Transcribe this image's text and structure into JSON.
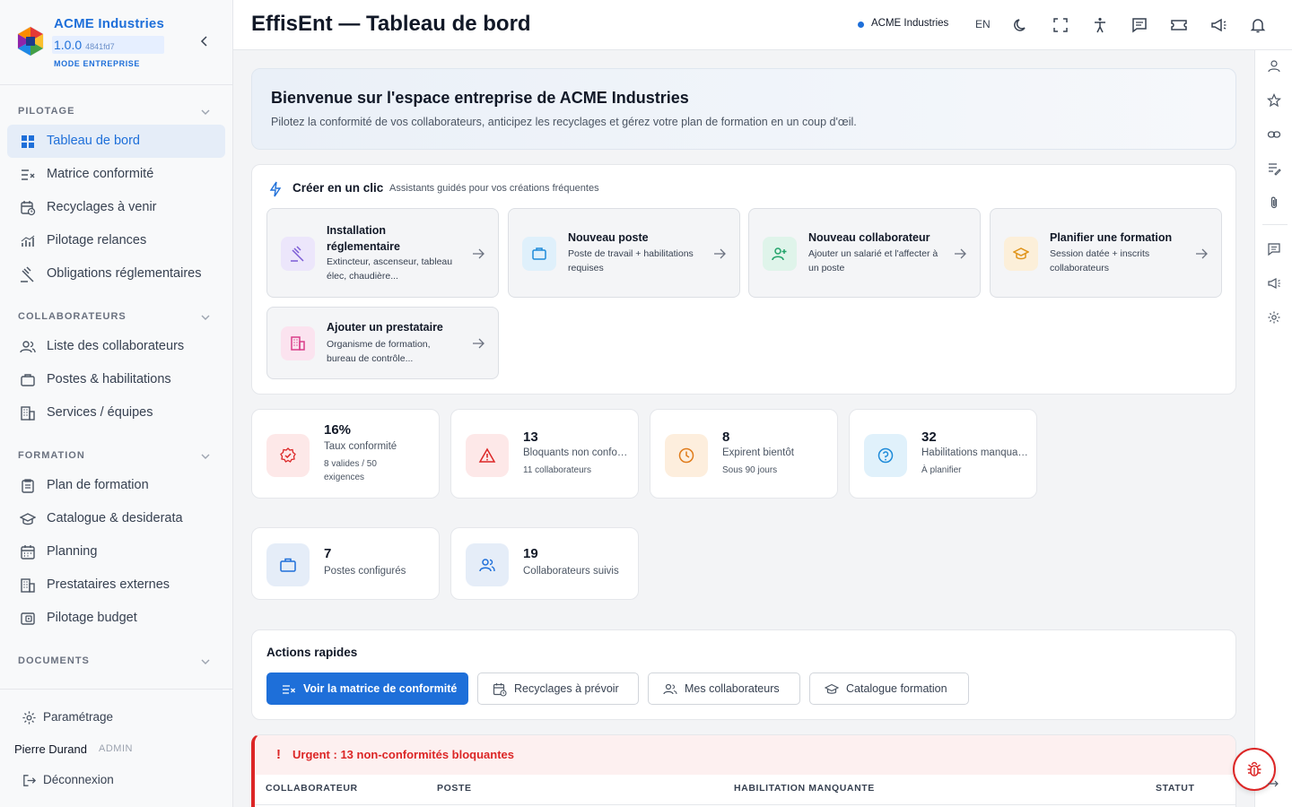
{
  "brand": {
    "name": "ACME Industries",
    "version": "1.0.0",
    "hash": "4841fd7",
    "mode": "MODE ENTREPRISE",
    "colors": {
      "primary": "#1e6fd9",
      "danger": "#dc2626"
    }
  },
  "nav": {
    "sections": [
      {
        "title": "PILOTAGE",
        "items": [
          {
            "label": "Tableau de bord",
            "icon": "grid-icon",
            "active": true
          },
          {
            "label": "Matrice conformité",
            "icon": "checklist-icon"
          },
          {
            "label": "Recyclages à venir",
            "icon": "calendar-clock-icon"
          },
          {
            "label": "Pilotage relances",
            "icon": "bar-chart-icon"
          },
          {
            "label": "Obligations réglementaires",
            "icon": "gavel-icon"
          }
        ]
      },
      {
        "title": "COLLABORATEURS",
        "items": [
          {
            "label": "Liste des collaborateurs",
            "icon": "users-icon"
          },
          {
            "label": "Postes & habilitations",
            "icon": "briefcase-icon"
          },
          {
            "label": "Services / équipes",
            "icon": "building-icon"
          }
        ]
      },
      {
        "title": "FORMATION",
        "items": [
          {
            "label": "Plan de formation",
            "icon": "clipboard-icon"
          },
          {
            "label": "Catalogue & desiderata",
            "icon": "graduation-cap-icon"
          },
          {
            "label": "Planning",
            "icon": "calendar-icon"
          },
          {
            "label": "Prestataires externes",
            "icon": "building-icon"
          },
          {
            "label": "Pilotage budget",
            "icon": "wallet-icon"
          }
        ]
      },
      {
        "title": "DOCUMENTS",
        "items": []
      }
    ]
  },
  "footer": {
    "settings_label": "Paramétrage",
    "user_name": "Pierre Durand",
    "user_role": "ADMIN",
    "logout_label": "Déconnexion"
  },
  "header": {
    "title": "EffisEnt — Tableau de bord",
    "org": "ACME Industries",
    "lang": "EN"
  },
  "welcome": {
    "title": "Bienvenue sur l'espace entreprise de ACME Industries",
    "text": "Pilotez la conformité de vos collaborateurs, anticipez les recyclages et gérez votre plan de formation en un coup d'œil."
  },
  "create": {
    "title": "Créer en un clic",
    "subtitle": "Assistants guidés pour vos créations fréquentes",
    "cards": [
      {
        "title": "Installation réglementaire",
        "desc": "Extincteur, ascenseur, tableau élec, chaudière...",
        "icon": "gavel-icon",
        "color": "#7c5cd6",
        "bg": "#ece6fb"
      },
      {
        "title": "Nouveau poste",
        "desc": "Poste de travail + habilitations requises",
        "icon": "briefcase-icon",
        "color": "#1e8bd9",
        "bg": "#dff0fb"
      },
      {
        "title": "Nouveau collaborateur",
        "desc": "Ajouter un salarié et l'affecter à un poste",
        "icon": "user-plus-icon",
        "color": "#22a36a",
        "bg": "#dff4ea"
      },
      {
        "title": "Planifier une formation",
        "desc": "Session datée + inscrits collaborateurs",
        "icon": "graduation-cap-icon",
        "color": "#e0941a",
        "bg": "#fcefd9"
      },
      {
        "title": "Ajouter un prestataire",
        "desc": "Organisme de formation, bureau de contrôle...",
        "icon": "building-icon",
        "color": "#d93e8a",
        "bg": "#fbe3ef"
      }
    ]
  },
  "stats": [
    {
      "value": "16%",
      "label": "Taux conformité",
      "sub": "8 valides / 50 exigences",
      "icon": "check-badge-icon",
      "color": "#dc2626",
      "bg": "#fde8e8"
    },
    {
      "value": "13",
      "label": "Bloquants non conformes",
      "sub": "11 collaborateurs",
      "icon": "warning-icon",
      "color": "#dc2626",
      "bg": "#fde8e8"
    },
    {
      "value": "8",
      "label": "Expirent bientôt",
      "sub": "Sous 90 jours",
      "icon": "clock-icon",
      "color": "#e07b1a",
      "bg": "#fdeedd"
    },
    {
      "value": "32",
      "label": "Habilitations manquantes",
      "sub": "À planifier",
      "icon": "help-circle-icon",
      "color": "#1e8bd9",
      "bg": "#e0f1fb"
    },
    {
      "value": "7",
      "label": "Postes configurés",
      "sub": "",
      "icon": "briefcase-icon",
      "color": "#1e6fd9",
      "bg": "#e5edf8"
    },
    {
      "value": "19",
      "label": "Collaborateurs suivis",
      "sub": "",
      "icon": "users-icon",
      "color": "#1e6fd9",
      "bg": "#e5edf8"
    }
  ],
  "actions": {
    "title": "Actions rapides",
    "buttons": [
      {
        "label": "Voir la matrice de conformité",
        "icon": "checklist-icon",
        "primary": true
      },
      {
        "label": "Recyclages à prévoir",
        "icon": "calendar-clock-icon"
      },
      {
        "label": "Mes collaborateurs",
        "icon": "users-icon"
      },
      {
        "label": "Catalogue formation",
        "icon": "graduation-cap-icon"
      }
    ]
  },
  "urgent": {
    "bang": "!",
    "title": "Urgent : 13 non-conformités bloquantes",
    "columns": [
      "COLLABORATEUR",
      "POSTE",
      "HABILITATION MANQUANTE",
      "STATUT"
    ]
  }
}
